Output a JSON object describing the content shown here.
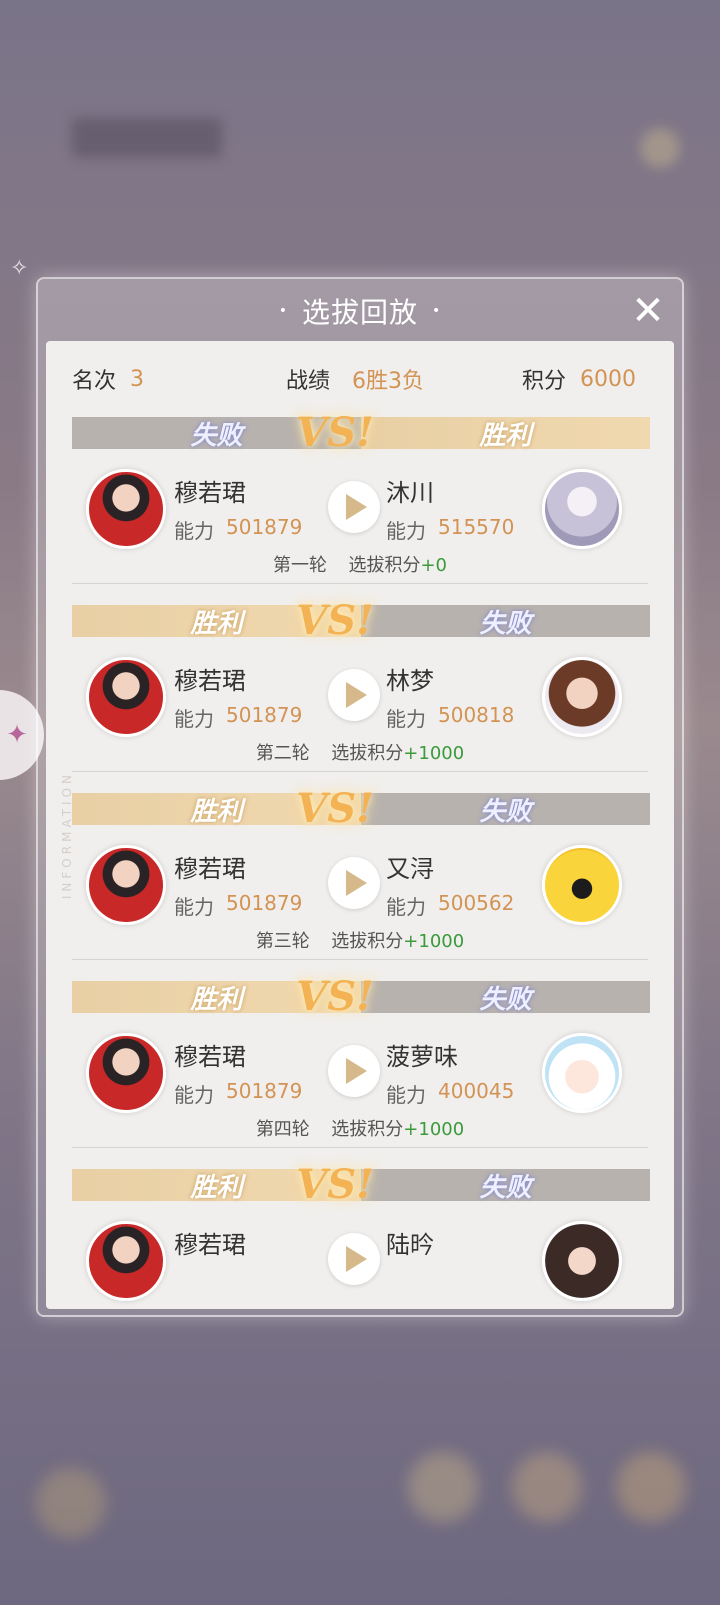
{
  "modal": {
    "title": "选拔回放",
    "close_icon": "close-icon"
  },
  "side_tab": {
    "icon": "feather-icon"
  },
  "summary": {
    "rank_label": "名次",
    "rank_value": "3",
    "record_label": "战绩",
    "record_value": "6胜3负",
    "score_label": "积分",
    "score_value": "6000"
  },
  "matches": [
    {
      "left_result": "失败",
      "right_result": "胜利",
      "vs": "VS!",
      "player": {
        "name": "穆若珺",
        "power_label": "能力",
        "power": "501879"
      },
      "opponent": {
        "name": "沐川",
        "power_label": "能力",
        "power": "515570"
      },
      "round": "第一轮",
      "points_label": "选拔积分",
      "points": "+0"
    },
    {
      "left_result": "胜利",
      "right_result": "失败",
      "vs": "VS!",
      "player": {
        "name": "穆若珺",
        "power_label": "能力",
        "power": "501879"
      },
      "opponent": {
        "name": "林梦",
        "power_label": "能力",
        "power": "500818"
      },
      "round": "第二轮",
      "points_label": "选拔积分",
      "points": "+1000"
    },
    {
      "left_result": "胜利",
      "right_result": "失败",
      "vs": "VS!",
      "player": {
        "name": "穆若珺",
        "power_label": "能力",
        "power": "501879"
      },
      "opponent": {
        "name": "又浔",
        "power_label": "能力",
        "power": "500562"
      },
      "round": "第三轮",
      "points_label": "选拔积分",
      "points": "+1000"
    },
    {
      "left_result": "胜利",
      "right_result": "失败",
      "vs": "VS!",
      "player": {
        "name": "穆若珺",
        "power_label": "能力",
        "power": "501879"
      },
      "opponent": {
        "name": "菠萝味",
        "power_label": "能力",
        "power": "400045"
      },
      "round": "第四轮",
      "points_label": "选拔积分",
      "points": "+1000"
    },
    {
      "left_result": "胜利",
      "right_result": "失败",
      "vs": "VS!",
      "player": {
        "name": "穆若珺"
      },
      "opponent": {
        "name": "陆昑"
      }
    }
  ],
  "watermark": "INFORMATION"
}
